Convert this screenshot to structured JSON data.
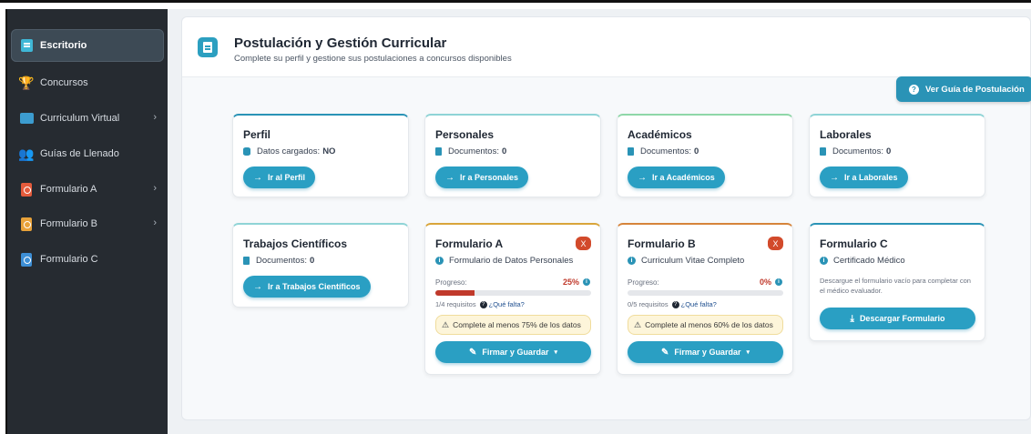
{
  "sidebar": {
    "items": [
      {
        "label": "Escritorio",
        "icon": "document-icon"
      },
      {
        "label": "Concursos",
        "icon": "trophy-icon"
      },
      {
        "label": "Curriculum Virtual",
        "icon": "id-card-icon",
        "has_submenu": true
      },
      {
        "label": "Guías de Llenado",
        "icon": "people-icon"
      },
      {
        "label": "Formulario A",
        "icon": "pdf-icon",
        "has_submenu": true
      },
      {
        "label": "Formulario B",
        "icon": "pdf-icon",
        "has_submenu": true
      },
      {
        "label": "Formulario C",
        "icon": "pdf-icon"
      }
    ],
    "chevron": "›"
  },
  "header": {
    "title": "Postulación y Gestión Curricular",
    "subtitle": "Complete su perfil y gestione sus postulaciones a concursos disponibles",
    "guide_button": "Ver Guía de Postulación",
    "guide_icon": "?"
  },
  "cards": {
    "perfil": {
      "title": "Perfil",
      "line_label": "Datos cargados:",
      "line_value": "NO",
      "button": "Ir al Perfil"
    },
    "personales": {
      "title": "Personales",
      "line_label": "Documentos:",
      "line_value": "0",
      "button": "Ir a Personales"
    },
    "academicos": {
      "title": "Académicos",
      "line_label": "Documentos:",
      "line_value": "0",
      "button": "Ir a Académicos"
    },
    "laborales": {
      "title": "Laborales",
      "line_label": "Documentos:",
      "line_value": "0",
      "button": "Ir a Laborales"
    },
    "trabajos": {
      "title": "Trabajos Científicos",
      "line_label": "Documentos:",
      "line_value": "0",
      "button": "Ir a Trabajos Científicos"
    },
    "formA": {
      "title": "Formulario A",
      "badge": "X",
      "subtitle": "Formulario de Datos Personales",
      "progress_label": "Progreso:",
      "progress_text": "25%",
      "progress_value": 25,
      "req_text": "1/4 requisitos",
      "req_link": "¿Qué falta?",
      "warning": "Complete al menos 75% de los datos",
      "button": "Firmar y Guardar"
    },
    "formB": {
      "title": "Formulario B",
      "badge": "X",
      "subtitle": "Curriculum Vitae Completo",
      "progress_label": "Progreso:",
      "progress_text": "0%",
      "progress_value": 0,
      "req_text": "0/5 requisitos",
      "req_link": "¿Qué falta?",
      "warning": "Complete al menos 60% de los datos",
      "button": "Firmar y Guardar"
    },
    "formC": {
      "title": "Formulario C",
      "subtitle": "Certificado Médico",
      "description": "Descargue el formulario vacío para completar con el médico evaluador.",
      "button": "Descargar Formulario"
    }
  },
  "glyphs": {
    "arrow": "→",
    "info": "i",
    "question": "?",
    "warning": "⚠",
    "pen": "✎",
    "caret": "▾",
    "download": "⤓"
  },
  "colors": {
    "accent": "#2a9fc3",
    "danger": "#c0392b",
    "sidebar": "#262b31",
    "warning_bg": "#fdf5da"
  }
}
